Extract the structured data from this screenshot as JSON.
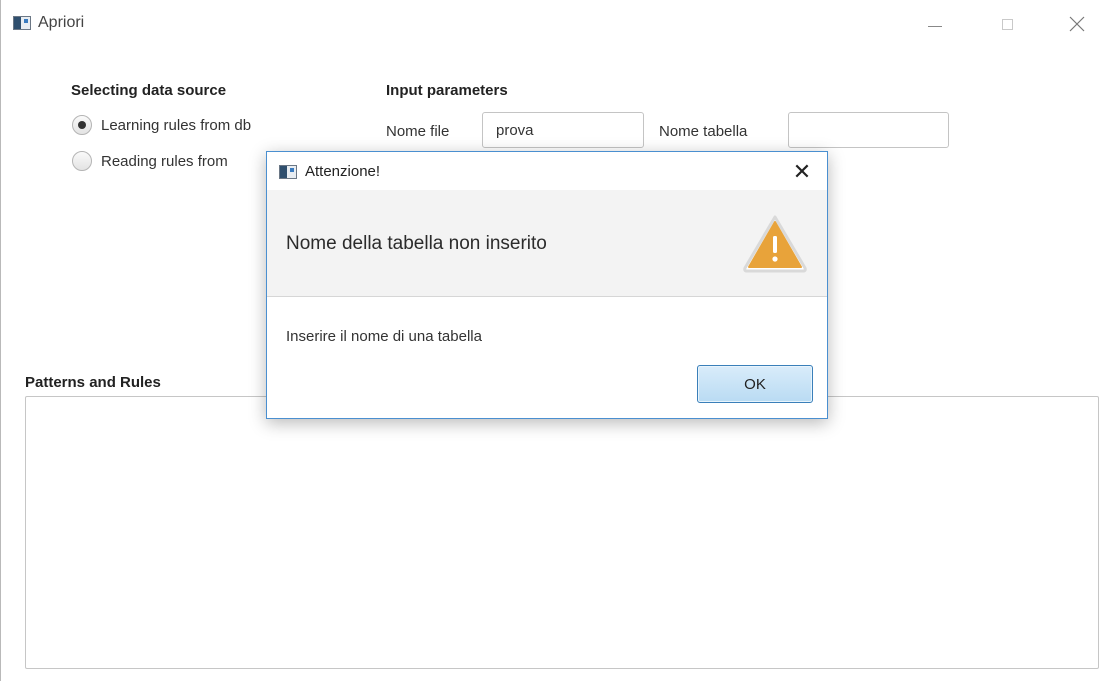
{
  "window": {
    "title": "Apriori"
  },
  "data_source": {
    "heading": "Selecting data source",
    "options": [
      {
        "label": "Learning rules from db",
        "checked": true
      },
      {
        "label": "Reading rules from",
        "checked": false
      }
    ]
  },
  "params": {
    "heading": "Input parameters",
    "file_label": "Nome file",
    "file_value": "prova",
    "table_label": "Nome tabella",
    "table_value": ""
  },
  "results": {
    "heading": "Patterns and Rules",
    "text": ""
  },
  "dialog": {
    "title": "Attenzione!",
    "header": "Nome della tabella non inserito",
    "content": "Inserire il nome di una tabella",
    "ok_label": "OK",
    "close_glyph": "✕",
    "icon": "warning-icon",
    "warning_color": "#e8a33a"
  }
}
